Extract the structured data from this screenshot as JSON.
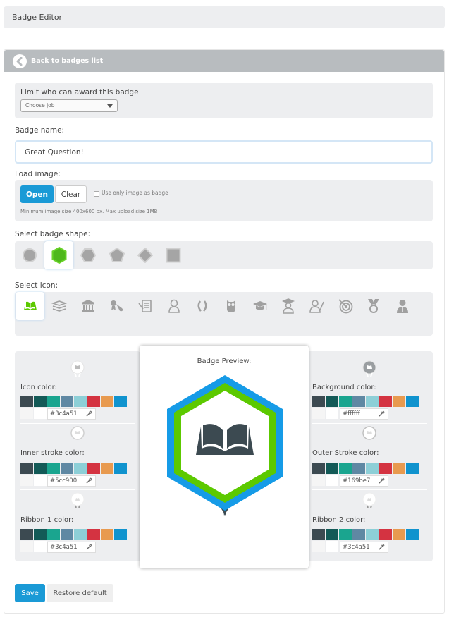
{
  "header": {
    "title": "Badge Editor"
  },
  "panel": {
    "back_label": "Back to badges list"
  },
  "award": {
    "label": "Limit who can award this badge",
    "select_value": "Choose job"
  },
  "badge_name": {
    "label": "Badge name:",
    "value": "Great Question!"
  },
  "load_image": {
    "label": "Load image:",
    "open_label": "Open",
    "clear_label": "Clear",
    "checkbox_label": "Use only image as badge",
    "checkbox_checked": false,
    "hint": "Minimum image size 400x600 px. Max upload size 1MB"
  },
  "shape": {
    "label": "Select badge shape:",
    "options": [
      "circle",
      "hexagon",
      "hexagon-flat",
      "pentagon",
      "diamond",
      "square"
    ],
    "selected": "hexagon"
  },
  "icon": {
    "label": "Select icon:",
    "options": [
      "open-book-icon",
      "books-stack-icon",
      "bank-icon",
      "diploma-icon",
      "certificate-icon",
      "person-icon",
      "laurel-icon",
      "owl-icon",
      "graduation-cap-icon",
      "graduate-icon",
      "teacher-icon",
      "target-icon",
      "medal-icon",
      "businessman-icon"
    ],
    "selected": "open-book-icon"
  },
  "palette": [
    "#3c4a51",
    "#135a57",
    "#1aa58f",
    "#5f88a3",
    "#8dcfd7",
    "#d43341",
    "#e89a4f",
    "#1093ce"
  ],
  "palette_row2": [
    "#f5f5f5",
    "#ffffff"
  ],
  "colors": {
    "icon": {
      "label": "Icon color:",
      "value": "#3c4a51"
    },
    "inner_stroke": {
      "label": "Inner stroke color:",
      "value": "#5cc900"
    },
    "ribbon1": {
      "label": "Ribbon 1 color:",
      "value": "#3c4a51"
    },
    "background": {
      "label": "Background color:",
      "value": "#ffffff"
    },
    "outer_stroke": {
      "label": "Outer Stroke color:",
      "value": "#169be7"
    },
    "ribbon2": {
      "label": "Ribbon 2 color:",
      "value": "#3c4a51"
    }
  },
  "preview": {
    "title": "Badge Preview:"
  },
  "actions": {
    "save_label": "Save",
    "restore_label": "Restore default"
  }
}
